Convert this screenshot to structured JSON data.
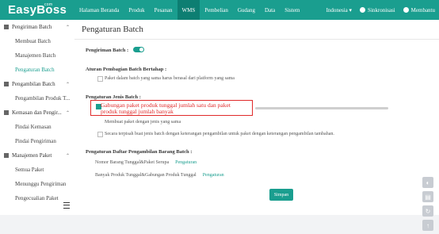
{
  "brand": {
    "name": "EasyBoss",
    "tag": "com"
  },
  "nav": {
    "items": [
      "Halaman Beranda",
      "Produk",
      "Pesanan",
      "WMS",
      "Pembelian",
      "Gudang",
      "Data",
      "Sistem"
    ],
    "active_index": 3,
    "language": "Indonesia",
    "sync": "Sinkronisasi",
    "help": "Membantu"
  },
  "sidebar": {
    "groups": [
      {
        "label": "Pengiriman Batch",
        "items": [
          "Membuat Batch",
          "Manajemen Batch",
          "Pengaturan Batch"
        ]
      },
      {
        "label": "Pengambilan Batch",
        "items": [
          "Pengambilan Produk T..."
        ]
      },
      {
        "label": "Kemasan dan Pengir...",
        "items": [
          "Pindai Kemasan",
          "Pindai Pengiriman"
        ]
      },
      {
        "label": "Manajemen Paket",
        "items": [
          "Semua Paket",
          "Menunggu Pengiriman",
          "Pengecualian Paket"
        ]
      }
    ],
    "active_item": "Pengaturan Batch"
  },
  "main": {
    "title": "Pengaturan Batch",
    "batch_delivery_label": "Pengiriman Batch :",
    "stepwise_rules_label": "Aturan Pembagian Batch Bertahap :",
    "stepwise_option": "Paket dalam batch yang sama harus berasal dari platform yang sama",
    "type_label": "Pengaturan Jenis Batch :",
    "type_option_highlighted": "Gabungan paket produk tunggal jumlah satu dan paket produk tunggal jumlah banyak",
    "type_option_2": "Membuat paket dengan jenis yang sama",
    "type_option_3": "Secara terpisah buat jenis batch dengan keterangan pengambilan untuk paket dengan keterangan pengambilan tambahan.",
    "pick_list_label": "Pengaturan Daftar Pengambilan Barang Batch :",
    "pick_row_1": "Nomor Barang Tunggal&Paket Serupa",
    "pick_row_2": "Banyak Produk Tunggal&Gabungan Produk Tunggal",
    "settings_link": "Pengaturan",
    "save_label": "Simpan"
  },
  "colors": {
    "accent": "#1a9e8f",
    "highlight": "#e02a2a"
  }
}
